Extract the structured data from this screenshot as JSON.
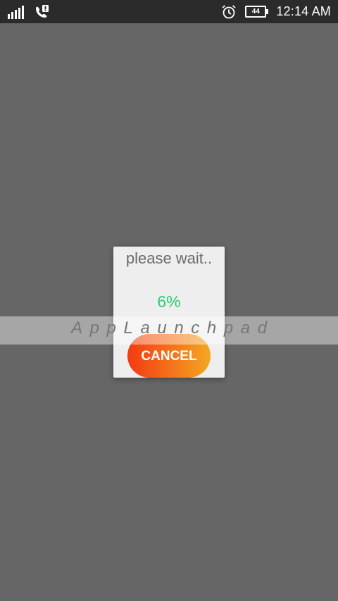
{
  "status_bar": {
    "time": "12:14 AM",
    "battery_level": "44",
    "icons": [
      "signal-icon",
      "phone-notification-icon",
      "alarm-icon",
      "battery-icon"
    ]
  },
  "dialog": {
    "title": "please wait..",
    "progress": "6%",
    "cancel_label": "CANCEL"
  },
  "watermark": {
    "text": "AppLaunchpad"
  },
  "colors": {
    "background": "#666666",
    "status_bar": "#2b2b2b",
    "dialog": "#eeeeee",
    "progress": "#2ecc71",
    "button_start": "#f23a12",
    "button_end": "#f3a822"
  }
}
